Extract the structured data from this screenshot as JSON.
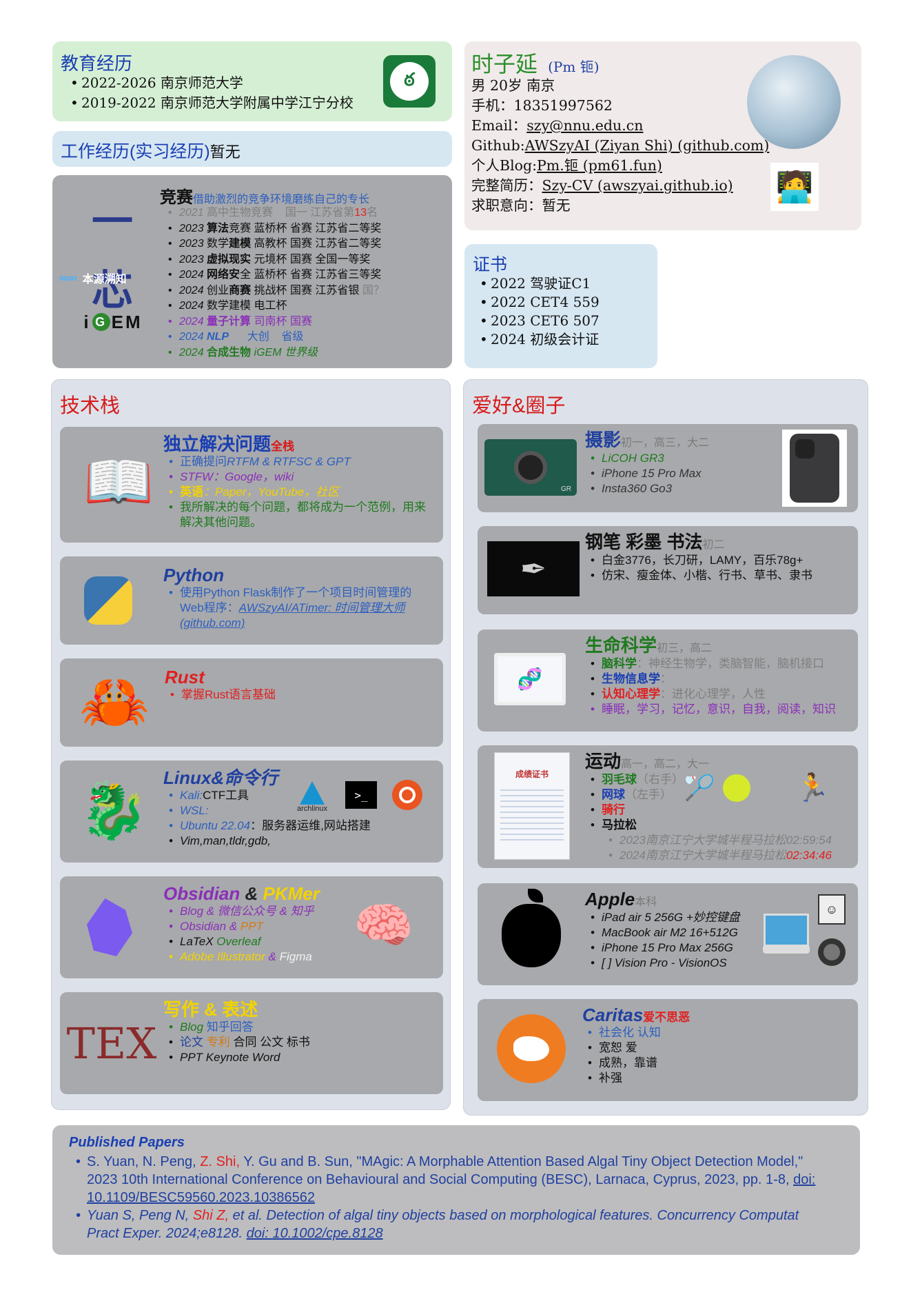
{
  "education": {
    "title": "教育经历",
    "items": [
      "2022-2026 南京师范大学",
      "2019-2022 南京师范大学附属中学江宁分校"
    ]
  },
  "work": {
    "title": "工作经历(实习经历)",
    "value": "暂无"
  },
  "contests": {
    "title": "竞赛",
    "subtitle": "借助激烈的竞争环境磨练自己的专长",
    "logo_text": "本源溯知",
    "items": [
      {
        "year": "2021",
        "name": "高中生物竞赛",
        "tail": "国一 江苏省第",
        "rank": "13",
        "suffix": "名"
      },
      {
        "year": "2023",
        "a": "算法",
        "b": "竞赛 蓝桥杯 省赛 江苏省二等奖"
      },
      {
        "year": "2023",
        "a": "数学",
        "b": "建模",
        "c": "高教杯 国赛 江苏省二等奖"
      },
      {
        "year": "2023",
        "a": "虚拟现实",
        "c": "元境杯 国赛 全国一等奖"
      },
      {
        "year": "2024",
        "a": "网络安",
        "b": "全",
        "c": "蓝桥杯 省赛 江苏省三等奖"
      },
      {
        "year": "2024",
        "a": "创业",
        "b": "商赛",
        "c": "挑战杯 国赛 江苏省银",
        "d": "国？"
      },
      {
        "year": "2024",
        "a": "数学建模 电工杯"
      },
      {
        "year": "2024",
        "a": "量子计算",
        "c": "司南杯 国赛"
      },
      {
        "year": "2024",
        "a": "NLP",
        "c": "大创",
        "d": "省级"
      },
      {
        "year": "2024",
        "a": "合成生物",
        "c": "iGEM 世界级"
      }
    ]
  },
  "profile": {
    "name": "时子延",
    "nick": "(Pm 钷)",
    "basic": "男 20岁 南京",
    "phone_label": "手机：",
    "phone": "18351997562",
    "email_label": "Email：",
    "email": "szy@nnu.edu.cn",
    "github_label": "Github:",
    "github": "AWSzyAI (Ziyan Shi) (github.com)",
    "blog_label": "个人Blog:",
    "blog": "Pm.钷 (pm61.fun)",
    "cv_label": "完整简历：",
    "cv": "Szy-CV (awszyai.github.io)",
    "intent_label": "求职意向：",
    "intent": "暂无"
  },
  "certs": {
    "title": "证书",
    "items": [
      "2022 驾驶证C1",
      "2022 CET4 559",
      "2023 CET6 507",
      "2024 初级会计证"
    ]
  },
  "tech": {
    "title": "技术栈",
    "solve": {
      "title": "独立解决问题",
      "tag": "全栈",
      "i1a": "正确提问",
      "i1b": "RTFM & RTFSC & GPT",
      "i2": "STFW：Google，wiki",
      "i3a": "英语",
      "i3b": "：Paper，YouTube，社区",
      "i4": "我所解决的每个问题，都将成为一个范例，用来解决其他问题。"
    },
    "python": {
      "title": "Python",
      "i1a": "使用Python Flask制作了一个项目时间管理的Web程序：",
      "i1b": "AWSzyAI/ATimer: 时间管理大师 (github.com)"
    },
    "rust": {
      "title": "Rust",
      "i1": "掌握Rust语言基础"
    },
    "linux": {
      "title": "Linux&命令行",
      "i1a": "Kali:",
      "i1b": "CTF工具",
      "i2": "WSL:",
      "i3a": "Ubuntu 22.04",
      "i3b": "：服务器运维,网站搭建",
      "i4": "Vim,man,tldr,gdb,",
      "arch": "archlinux"
    },
    "obsidian": {
      "title1": "Obsidian",
      "amp": " & ",
      "title2": "PKMer",
      "i1": "Blog & 微信公众号 & 知乎",
      "i2a": "Obsidian & ",
      "i2b": "PPT",
      "i3a": "LaTeX ",
      "i3b": "Overleaf",
      "i4a": "Adobe Illustrator",
      "i4b": " & ",
      "i4c": "Figma"
    },
    "writing": {
      "title": "写作 & 表述",
      "i1a": "Blog ",
      "i1b": "知乎回答",
      "i2a": "论文",
      "i2b": "专利",
      "i2c": "合同 公文 标书",
      "i3": "PPT Keynote Word",
      "tex": "TEX"
    }
  },
  "hobby": {
    "title": "爱好&圈子",
    "photo": {
      "title": "摄影",
      "note": "初一，高三，大二",
      "items": [
        "LiCOH GR3",
        "iPhone 15 Pro Max",
        "Insta360 Go3"
      ],
      "cam": "GR"
    },
    "pen": {
      "title": "钢笔 彩墨 书法",
      "note": "初二",
      "items": [
        "白金3776，长刀研，LAMY，百乐78g+",
        "仿宋、瘦金体、小楷、行书、草书、隶书"
      ]
    },
    "life": {
      "title": "生命科学",
      "note": "初三，高二",
      "i1a": "脑科学",
      "i1b": "：神经生物学，类脑智能，脑机接口",
      "i2a": "生物信息学",
      "i2b": "：",
      "i3a": "认知心理学",
      "i3b": "：进化心理学，人性",
      "i4": "睡眠，学习，记忆，意识，自我，阅读，知识"
    },
    "sport": {
      "title": "运动",
      "note": "高一，高二，大一",
      "i1a": "羽毛球",
      "i1b": "（右手）",
      "i2a": "网球",
      "i2b": "（左手）",
      "i3": "骑行",
      "i4": "马拉松",
      "m1a": "2023南京江宁大学城半程马拉松",
      "m1b": "02:59:54",
      "m2a": "2024南京江宁大学城半程马拉松",
      "m2b": "02:34:46",
      "cert_title": "成绩证书"
    },
    "apple": {
      "title": "Apple",
      "note": "本科",
      "items": [
        "iPad air 5 256G +妙控键盘",
        "MacBook air M2 16+512G",
        "iPhone 15 Pro Max   256G",
        "[ ] Vision Pro  -  VisionOS"
      ]
    },
    "caritas": {
      "title": "Caritas",
      "tag": "爱不思恶",
      "items": [
        "社会化 认知",
        "宽恕 爱",
        "成熟，靠谱",
        "补强"
      ]
    }
  },
  "papers": {
    "title": "Published Papers",
    "p1a": "S. Yuan, N. Peng, ",
    "p1b": "Z. Shi,",
    "p1c": " Y. Gu and B. Sun, \"MAgic: A Morphable Attention Based Algal Tiny Object Detection Model,\" 2023 10th International Conference on Behavioural and Social Computing (BESC), Larnaca, Cyprus, 2023, pp. 1-8, ",
    "p1d": "doi: 10.1109/BESC59560.2023.10386562",
    "p2a": "Yuan S,  Peng N,  ",
    "p2b": "Shi Z,",
    "p2c": " et al.  Detection of algal tiny objects based on morphological features. Concurrency Computat Pract Exper.  2024;e8128. ",
    "p2d": "doi: 10.1002/cpe.8128"
  },
  "colors": {
    "edu_bg": "#d5efd4",
    "work_bg": "#d6e7f2",
    "gray_card": "#a8a9ac",
    "panel_bg": "#dde2ea",
    "title_red": "#d71a1a",
    "title_blue": "#1a3fb2"
  }
}
